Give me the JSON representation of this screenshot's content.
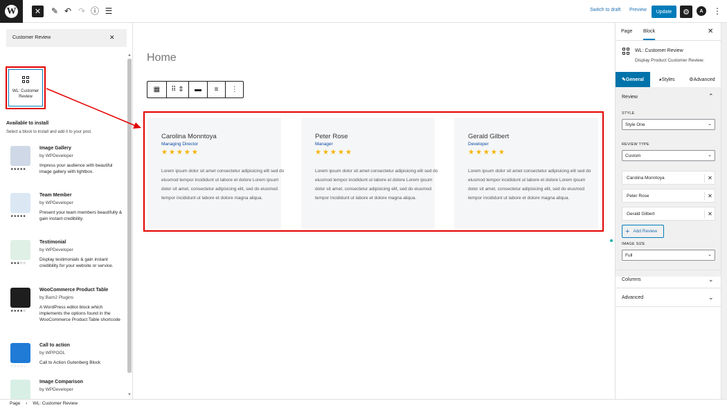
{
  "topbar": {
    "switch_draft": "Switch to draft",
    "preview": "Preview",
    "update": "Update"
  },
  "inserter": {
    "search_value": "Customer Review",
    "result_block": "WL: Customer Review",
    "available_title": "Available to install",
    "available_sub": "Select a block to install and add it to your post.",
    "plugins": [
      {
        "name": "Image Gallery",
        "by": "by WPDeveloper",
        "desc": "Impress your audience with beautiful image gallery with lightbox.",
        "stars": "★★★★★",
        "color": "#cfd8e6"
      },
      {
        "name": "Team Member",
        "by": "by WPDeveloper",
        "desc": "Present your team members beautifully & gain instant credibility.",
        "stars": "★★★★★",
        "color": "#dbe8f4"
      },
      {
        "name": "Testimonial",
        "by": "by WPDeveloper",
        "desc": "Display testimonials & gain instant credibility for your website or service.",
        "stars": "★★★☆☆",
        "color": "#dff0e6"
      },
      {
        "name": "WooCommerce Product Table",
        "by": "by Barn2 Plugins",
        "desc": "A WordPress editor block which implements the options found in the WooCommerce Product Table shortcode",
        "stars": "★★★★☆",
        "color": "#1e1e1e"
      },
      {
        "name": "Call to action",
        "by": "by WPPOOL",
        "desc": "Call to Action Gutenberg Block",
        "stars": "☆☆☆☆☆",
        "color": "#1f7bd6"
      },
      {
        "name": "Image Comparison",
        "by": "by WPDeveloper",
        "desc": "",
        "stars": "",
        "color": "#d8efe6"
      }
    ]
  },
  "canvas": {
    "page_title": "Home",
    "reviews": [
      {
        "name": "Carolina Monntoya",
        "role": "Managing Director",
        "stars": "★★★★★",
        "text": "Lorem ipsum dolor sit amet consectetur adipisicing elit sed do eiusmod tempor incididunt ut labore et dolore Lorem ipsum dolor sit amet, consectetur adipisicing elit, sed do eiusmod tempor incididunt ut labore et dolore magna aliqua."
      },
      {
        "name": "Peter Rose",
        "role": "Manager",
        "stars": "★★★★★",
        "text": "Lorem ipsum dolor sit amet consectetur adipisicing elit sed do eiusmod tempor incididunt ut labore et dolore Lorem ipsum dolor sit amet, consectetur adipisicing elit, sed do eiusmod tempor incididunt ut labore et dolore magna aliqua."
      },
      {
        "name": "Gerald Gilbert",
        "role": "Developer",
        "stars": "★★★★★",
        "text": "Lorem ipsum dolor sit amet consectetur adipisicing elit sed do eiusmod tempor incididunt ut labore et dolore Lorem ipsum dolor sit amet, consectetur adipisicing elit, sed do eiusmod tempor incididunt ut labore et dolore magna aliqua."
      }
    ],
    "star_color": "#f4b400",
    "highlight_color": "#e30000"
  },
  "sidebar": {
    "tab_page": "Page",
    "tab_block": "Block",
    "block_title": "WL: Customer Review",
    "block_desc": "Display Product Customer Review.",
    "tab_general": "General",
    "tab_styles": "Styles",
    "tab_advanced": "Advanced",
    "panel_review": "Review",
    "style_label": "STYLE",
    "style_value": "Style One",
    "review_type_label": "REVIEW TYPE",
    "review_type_value": "Custom",
    "items": [
      "Carolina Monntoya",
      "Peter Rose",
      "Gerald Gilbert"
    ],
    "add_review": "Add Review",
    "image_size_label": "IMAGE SIZE",
    "image_size_value": "Full",
    "panel_columns": "Columns",
    "panel_advanced": "Advanced",
    "accent_color": "#007cba"
  },
  "footer": {
    "crumb_page": "Page",
    "crumb_block": "WL: Customer Review"
  }
}
